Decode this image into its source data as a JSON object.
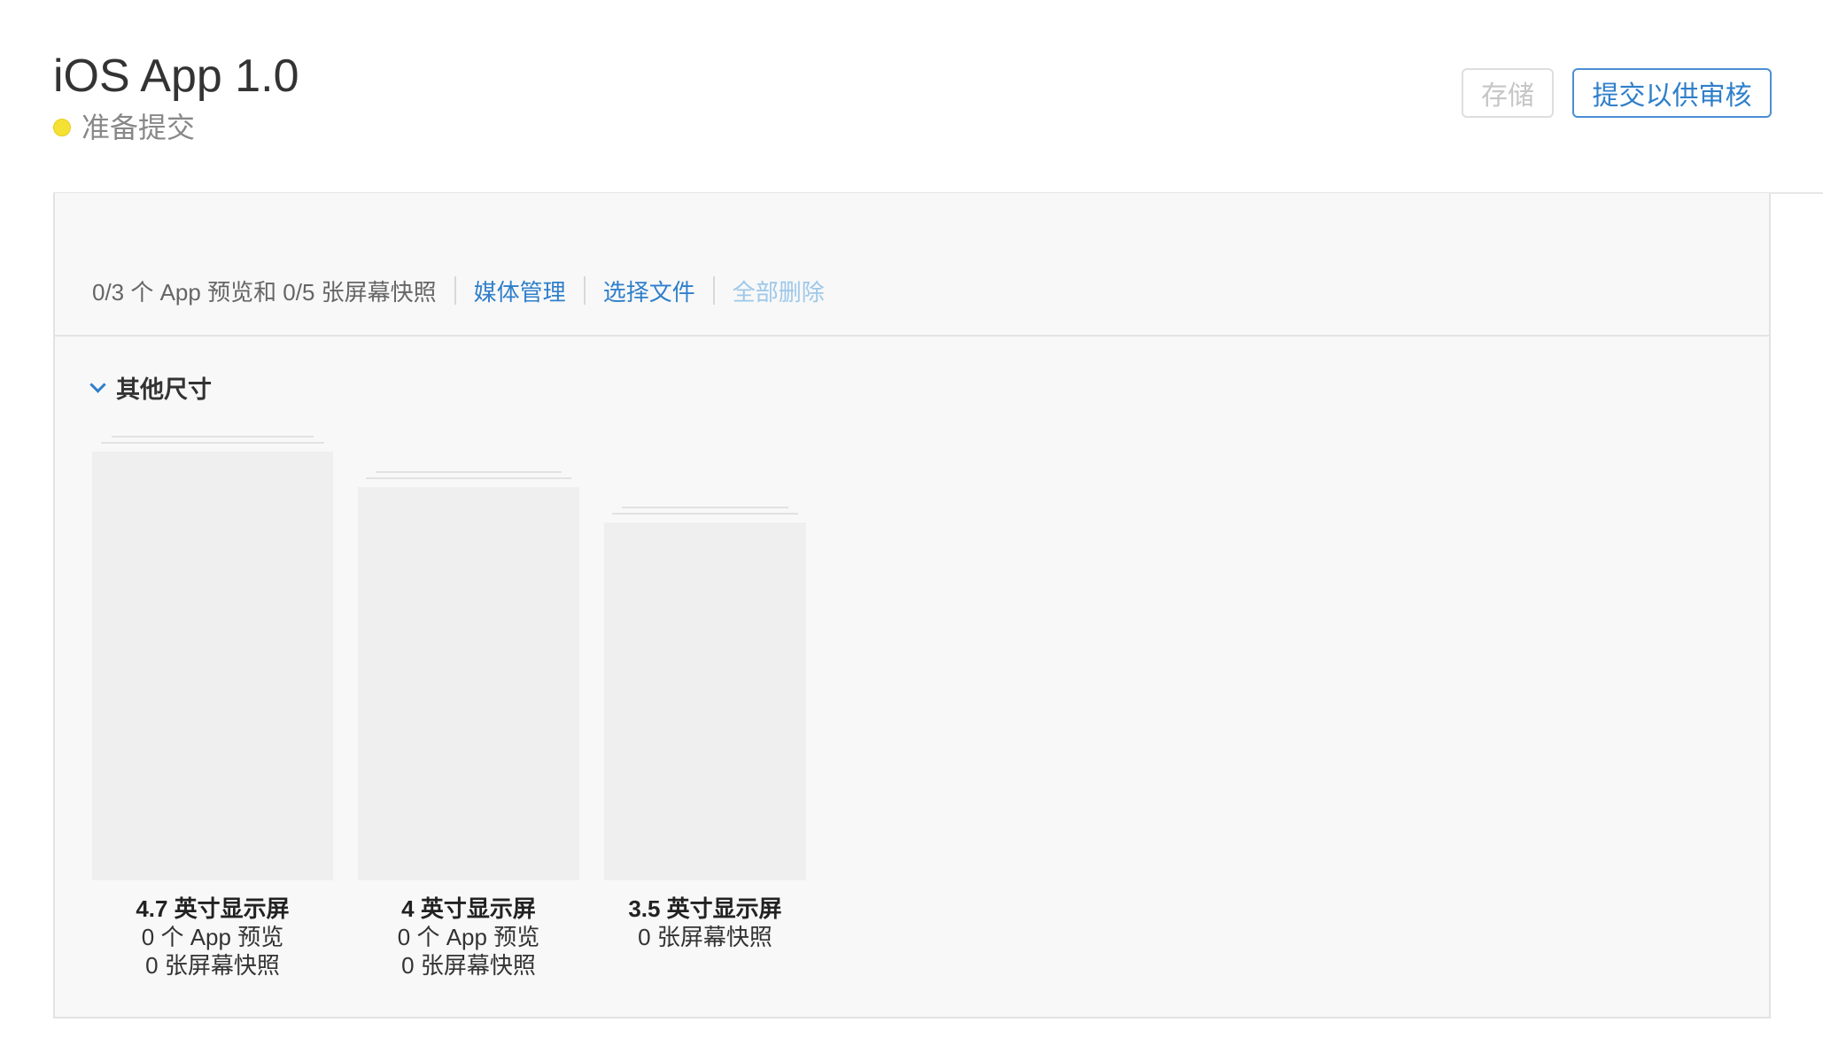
{
  "header": {
    "title": "iOS App 1.0",
    "status": "准备提交",
    "status_color": "#f5e133"
  },
  "actions": {
    "save_label": "存储",
    "submit_label": "提交以供审核"
  },
  "toolbar": {
    "count_text": "0/3 个 App 预览和 0/5 张屏幕快照",
    "media_manage": "媒体管理",
    "choose_file": "选择文件",
    "delete_all": "全部删除"
  },
  "section": {
    "title": "其他尺寸"
  },
  "slots": [
    {
      "title": "4.7 英寸显示屏",
      "previews": "0 个 App 预览",
      "screenshots": "0 张屏幕快照"
    },
    {
      "title": "4 英寸显示屏",
      "previews": "0 个 App 预览",
      "screenshots": "0 张屏幕快照"
    },
    {
      "title": "3.5 英寸显示屏",
      "screenshots": "0 张屏幕快照"
    }
  ],
  "colors": {
    "accent": "#2f7fcb",
    "disabled_link": "#9ec8ea"
  }
}
